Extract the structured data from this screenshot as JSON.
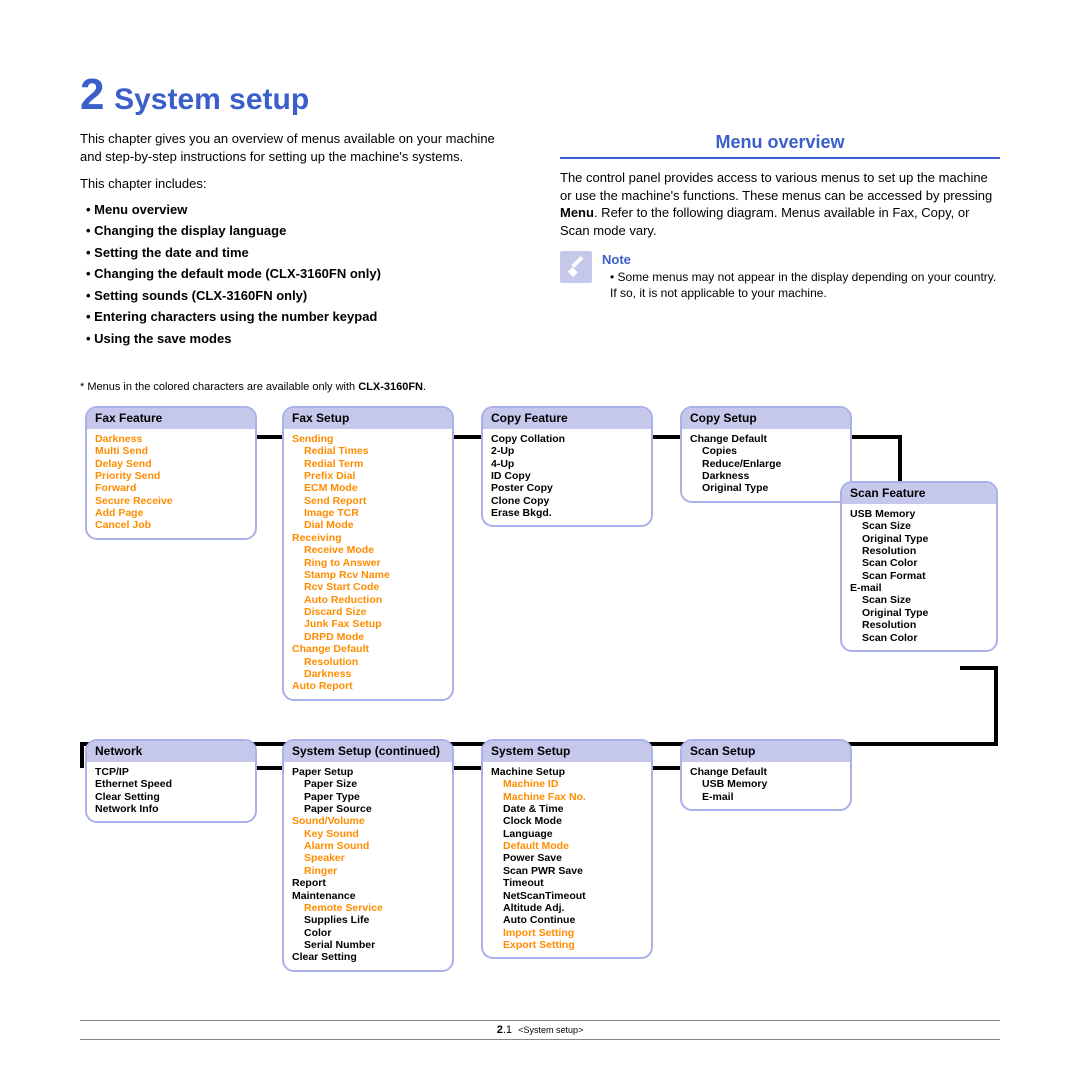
{
  "chapter_number": "2",
  "chapter_title": "System setup",
  "intro_text": "This chapter gives you an overview of menus available on your machine and step-by-step instructions for setting up the machine's systems.",
  "includes_label": "This chapter includes:",
  "bullets": [
    "Menu overview",
    "Changing the display language",
    "Setting the date and time",
    "Changing the default mode (CLX-3160FN only)",
    "Setting sounds (CLX-3160FN only)",
    "Entering characters using the number keypad",
    "Using the save modes"
  ],
  "section_header": "Menu overview",
  "overview_text_1": "The control panel provides access to various menus to set up the machine or use the machine's functions. These menus can be accessed by pressing ",
  "overview_menu_word": "Menu",
  "overview_text_2": ". Refer to the following diagram. Menus available in Fax, Copy, or Scan mode vary.",
  "note_label": "Note",
  "note_text": "Some menus may not appear in the display depending on your country. If so, it is not applicable to your machine.",
  "footnote_prefix": "* Menus in the colored characters are available only with ",
  "footnote_model": "CLX-3160FN",
  "footnote_suffix": ".",
  "footer_page": "2",
  "footer_sub": ".1",
  "footer_crumb": "<System setup>",
  "boxes": {
    "fax_feature": {
      "title": "Fax Feature",
      "items": [
        "Darkness",
        "Multi Send",
        "Delay Send",
        "Priority Send",
        "Forward",
        "Secure Receive",
        "Add Page",
        "Cancel Job"
      ]
    },
    "fax_setup": {
      "title": "Fax Setup",
      "sending_label": "Sending",
      "sending_items": [
        "Redial Times",
        "Redial Term",
        "Prefix Dial",
        "ECM Mode",
        "Send Report",
        "Image TCR",
        "Dial Mode"
      ],
      "receiving_label": "Receiving",
      "receiving_items": [
        "Receive Mode",
        "Ring to Answer",
        "Stamp Rcv Name",
        "Rcv Start Code",
        "Auto Reduction",
        "Discard Size",
        "Junk Fax Setup",
        "DRPD Mode"
      ],
      "change_default_label": "Change Default",
      "change_default_items": [
        "Resolution",
        "Darkness"
      ],
      "auto_report": "Auto Report"
    },
    "copy_feature": {
      "title": "Copy Feature",
      "items": [
        "Copy Collation",
        "2-Up",
        "4-Up",
        "ID Copy",
        "Poster Copy",
        "Clone Copy",
        "Erase Bkgd."
      ]
    },
    "copy_setup": {
      "title": "Copy Setup",
      "change_default_label": "Change Default",
      "items": [
        "Copies",
        "Reduce/Enlarge",
        "Darkness",
        "Original Type"
      ]
    },
    "scan_feature": {
      "title": "Scan Feature",
      "usb_label": "USB Memory",
      "usb_items": [
        "Scan Size",
        "Original Type",
        "Resolution",
        "Scan Color",
        "Scan Format"
      ],
      "email_label": "E-mail",
      "email_items": [
        "Scan Size",
        "Original Type",
        "Resolution",
        "Scan Color"
      ]
    },
    "network": {
      "title": "Network",
      "items": [
        "TCP/IP",
        "Ethernet Speed",
        "Clear Setting",
        "Network Info"
      ]
    },
    "system_setup_cont": {
      "title": "System Setup (continued)",
      "paper_setup_label": "Paper Setup",
      "paper_setup_items": [
        "Paper Size",
        "Paper Type",
        "Paper Source"
      ],
      "sound_label": "Sound/Volume",
      "sound_items": [
        "Key Sound",
        "Alarm Sound",
        "Speaker",
        "Ringer"
      ],
      "report_label": "Report",
      "maintenance_label": "Maintenance",
      "maintenance_items_orange": [
        "Remote Service"
      ],
      "maintenance_items_black": [
        "Supplies Life",
        "Color",
        "Serial Number"
      ],
      "clear_setting": "Clear Setting"
    },
    "system_setup": {
      "title": "System Setup",
      "machine_setup_label": "Machine Setup",
      "machine_orange_1": [
        "Machine ID",
        "Machine Fax No."
      ],
      "machine_black_1": [
        "Date & Time",
        "Clock Mode",
        "Language"
      ],
      "machine_orange_2": [
        "Default Mode"
      ],
      "machine_black_2": [
        "Power Save",
        "Scan PWR Save",
        "Timeout",
        "NetScanTimeout",
        "Altitude Adj.",
        "Auto Continue"
      ],
      "machine_orange_3": [
        "Import Setting",
        "Export Setting"
      ]
    },
    "scan_setup": {
      "title": "Scan Setup",
      "change_default_label": "Change Default",
      "items": [
        "USB Memory",
        "E-mail"
      ]
    }
  }
}
